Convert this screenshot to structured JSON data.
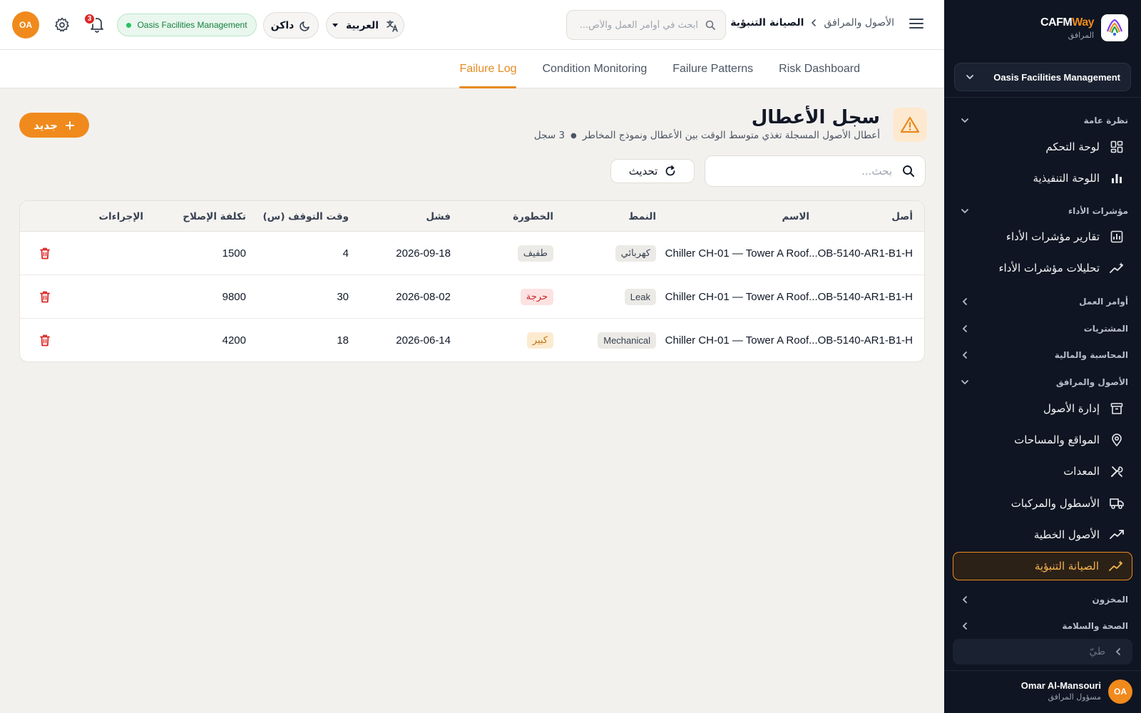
{
  "sidebar": {
    "brand_cafm": "CAFM",
    "brand_way": "Way",
    "brand_sub": "المرافق",
    "org_name": "Oasis Facilities Management",
    "sections": {
      "overview": "نظرة عامة",
      "kpis": "مؤشرات الأداء",
      "work_orders": "أوامر العمل",
      "procurement": "المشتريات",
      "finance": "المحاسبة والمالية",
      "assets": "الأصول والمرافق",
      "inventory": "المخزون",
      "hse": "الصحة والسلامة"
    },
    "items": {
      "dashboard": "لوحة التحكم",
      "executive": "اللوحة التنفيذية",
      "kpi_reports": "تقارير مؤشرات الأداء",
      "kpi_analytics": "تحليلات مؤشرات الأداء",
      "asset_management": "إدارة الأصول",
      "locations": "المواقع والمساحات",
      "equipment": "المعدات",
      "fleet": "الأسطول والمركبات",
      "linear_assets": "الأصول الخطية",
      "predictive": "الصيانة التنبؤية"
    },
    "collapse_label": "طيّ",
    "user": {
      "initials": "OA",
      "name": "Omar Al-Mansouri",
      "role": "مسؤول المرافق"
    }
  },
  "topbar": {
    "breadcrumb_parent": "الأصول والمرافق",
    "breadcrumb_current": "الصيانة التنبؤية",
    "search_placeholder": "ابحث في أوامر العمل والأص...",
    "language": "العربية",
    "theme": "داكن",
    "org_badge": "Oasis Facilities Management",
    "notification_count": "3",
    "avatar_initials": "OA"
  },
  "tabs": {
    "failure_log": "Failure Log",
    "condition_monitoring": "Condition Monitoring",
    "failure_patterns": "Failure Patterns",
    "risk_dashboard": "Risk Dashboard"
  },
  "page": {
    "title": "سجل الأعطال",
    "subtitle": "أعطال الأصول المسجلة تغذي متوسط الوقت بين الأعطال ونموذج المخاطر",
    "record_count": "3 سجل",
    "new_button": "جديد",
    "search_placeholder": "بحث...",
    "refresh_button": "تحديث"
  },
  "table": {
    "headers": {
      "asset": "أصل",
      "name": "الاسم",
      "type": "النمط",
      "severity": "الخطورة",
      "failure": "فشل",
      "downtime": "وقت التوقف (س)",
      "repair_cost": "تكلفة الإصلاح",
      "actions": "الإجراءات"
    },
    "rows": [
      {
        "name": "Chiller CH-01 — Tower A Roof...OB-5140-AR1-B1-H",
        "type": "كهربائي",
        "severity": "طفيف",
        "date": "2026-09-18",
        "downtime": "4",
        "cost": "1500"
      },
      {
        "name": "Chiller CH-01 — Tower A Roof...OB-5140-AR1-B1-H",
        "type": "Leak",
        "severity": "حرجة",
        "date": "2026-08-02",
        "downtime": "30",
        "cost": "9800"
      },
      {
        "name": "Chiller CH-01 — Tower A Roof...OB-5140-AR1-B1-H",
        "type": "Mechanical",
        "severity": "كبير",
        "date": "2026-06-14",
        "downtime": "18",
        "cost": "4200"
      }
    ]
  },
  "colors": {
    "accent": "#f08a1d",
    "sidebar_bg": "#0f1522",
    "danger": "#dc2626",
    "success": "#22c55e"
  }
}
